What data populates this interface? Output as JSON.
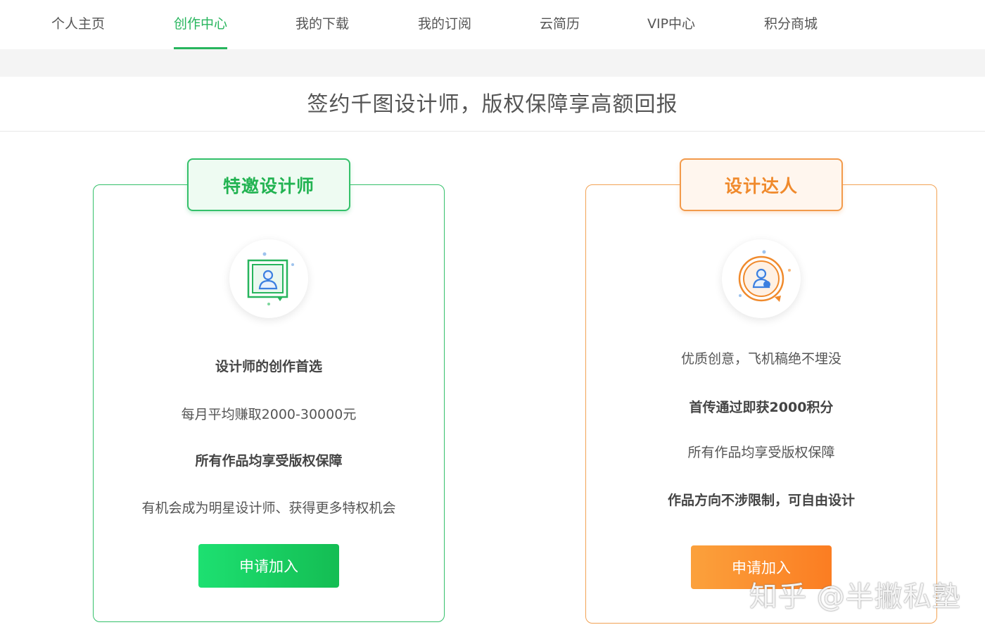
{
  "nav": {
    "items": [
      {
        "label": "个人主页"
      },
      {
        "label": "创作中心",
        "active": true
      },
      {
        "label": "我的下载"
      },
      {
        "label": "我的订阅"
      },
      {
        "label": "云简历"
      },
      {
        "label": "VIP中心"
      },
      {
        "label": "积分商城"
      }
    ]
  },
  "headline": "签约千图设计师，版权保障享高额回报",
  "cards": {
    "designer": {
      "tag": "特邀设计师",
      "icon": "designer-portrait-icon",
      "lines": [
        "设计师的创作首选",
        "每月平均赚取2000-30000元",
        "所有作品均享受版权保障",
        "有机会成为明星设计师、获得更多特权机会"
      ],
      "button": "申请加入"
    },
    "expert": {
      "tag": "设计达人",
      "icon": "expert-medal-icon",
      "lines": [
        "优质创意，飞机稿绝不埋没",
        "首传通过即获2000积分",
        "所有作品均享受版权保障",
        "作品方向不涉限制，可自由设计"
      ],
      "button": "申请加入"
    }
  },
  "watermark": "知乎 @半撇私塾",
  "colors": {
    "accent_green": "#27b55d",
    "accent_orange": "#f08a2c"
  }
}
